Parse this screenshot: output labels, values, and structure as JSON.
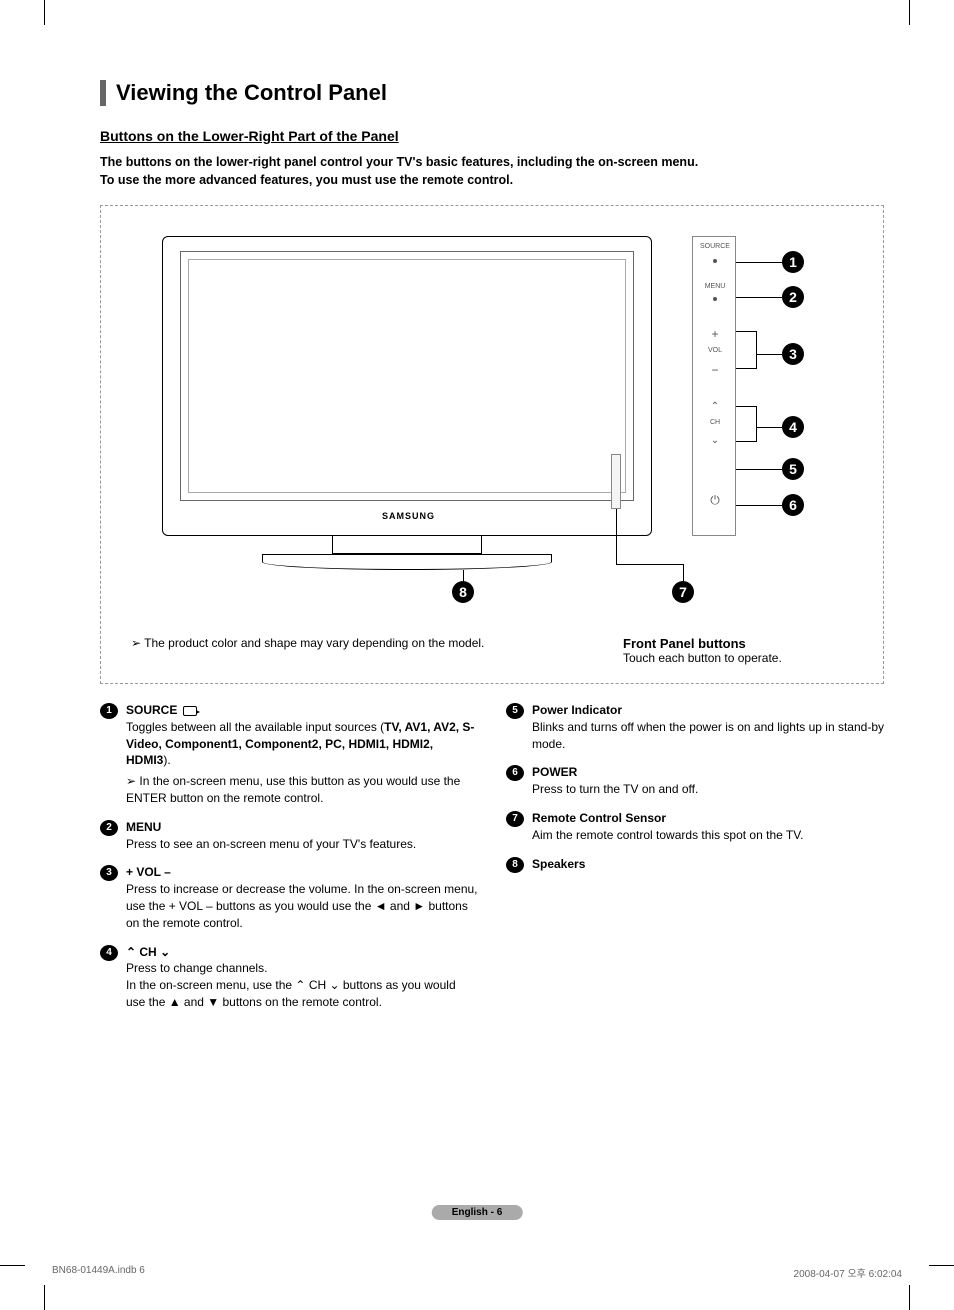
{
  "page_title": "Viewing the Control Panel",
  "subtitle": "Buttons on the Lower-Right Part of the Panel",
  "intro_line1": "The buttons on the lower-right panel control your TV's basic features, including the on-screen menu.",
  "intro_line2": "To use the more advanced features, you must use the remote control.",
  "diagram": {
    "brand": "SAMSUNG",
    "panel_labels": {
      "source": "SOURCE",
      "menu": "MENU",
      "vol": "VOL",
      "ch": "CH"
    },
    "callouts": [
      "1",
      "2",
      "3",
      "4",
      "5",
      "6",
      "7",
      "8"
    ],
    "note": "The product color and shape may vary depending on the model.",
    "front_panel_title": "Front Panel buttons",
    "front_panel_sub": "Touch each button to operate."
  },
  "items_left": [
    {
      "n": "1",
      "title": "SOURCE",
      "body": "Toggles between all the available input sources (",
      "bold_list": "TV, AV1, AV2, S-Video, Component1, Component2, PC, HDMI1, HDMI2, HDMI3",
      "body_end": ").",
      "sub": "In the on-screen menu, use this button as you would use the ENTER button on the remote control."
    },
    {
      "n": "2",
      "title": "MENU",
      "body": "Press to see an on-screen menu of your TV's features."
    },
    {
      "n": "3",
      "title": "+ VOL –",
      "body": "Press to increase or decrease the volume. In the on-screen menu, use the + VOL – buttons as you would use the ◄ and ► buttons on the remote control."
    },
    {
      "n": "4",
      "title_pre": "⌃ ",
      "title": "CH",
      "title_post": " ⌄",
      "body": "Press to change channels.",
      "body2": "In the on-screen menu, use the ⌃ CH ⌄ buttons as you would use the ▲ and ▼ buttons on the remote control."
    }
  ],
  "items_right": [
    {
      "n": "5",
      "title": "Power Indicator",
      "body": "Blinks and turns off when the power is on and lights up in stand-by mode."
    },
    {
      "n": "6",
      "title": "POWER",
      "body": "Press to turn the TV on and off."
    },
    {
      "n": "7",
      "title": "Remote Control Sensor",
      "body": "Aim the remote control towards this spot on the TV."
    },
    {
      "n": "8",
      "title": "Speakers",
      "body": ""
    }
  ],
  "footer": {
    "page_label": "English - 6",
    "print_file": "BN68-01449A.indb   6",
    "print_time": "2008-04-07   오후 6:02:04"
  }
}
